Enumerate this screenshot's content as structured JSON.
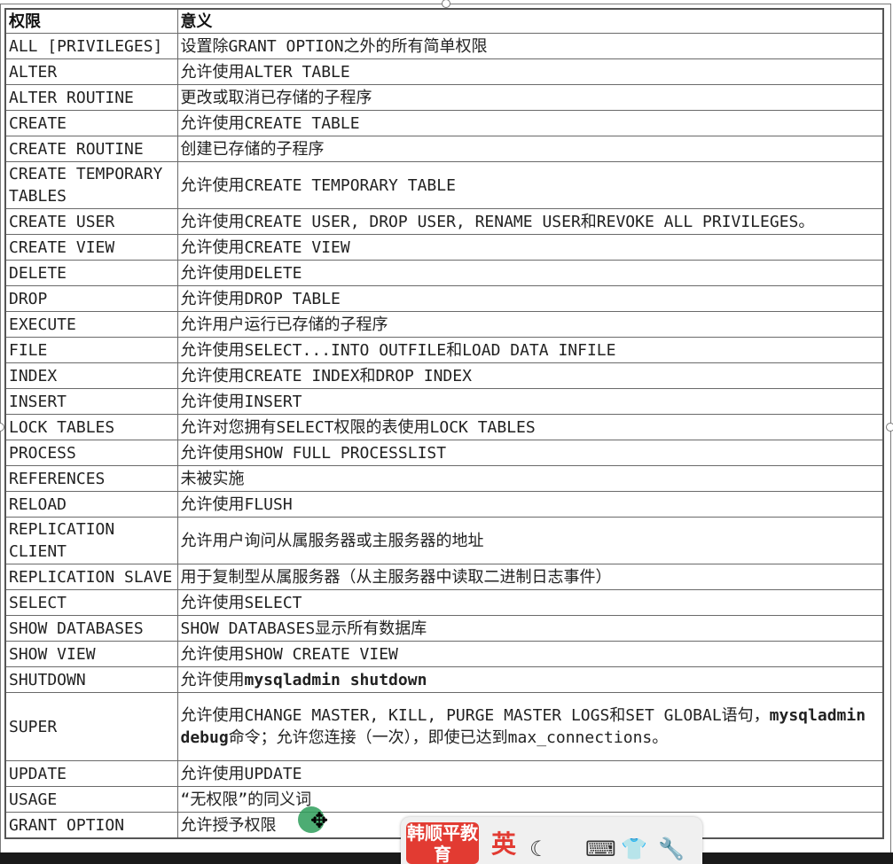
{
  "table": {
    "header": {
      "col1": "权限",
      "col2": "意义"
    },
    "rows": [
      {
        "priv": "ALL [PRIVILEGES]",
        "meaning": "设置除GRANT OPTION之外的所有简单权限",
        "h": 1
      },
      {
        "priv": "ALTER",
        "meaning": "允许使用ALTER TABLE",
        "h": 1
      },
      {
        "priv": "ALTER ROUTINE",
        "meaning": "更改或取消已存储的子程序",
        "h": 1
      },
      {
        "priv": "CREATE",
        "meaning": "允许使用CREATE TABLE",
        "h": 1
      },
      {
        "priv": "CREATE ROUTINE",
        "meaning": "创建已存储的子程序",
        "h": 1
      },
      {
        "priv": "CREATE TEMPORARY TABLES",
        "meaning": "允许使用CREATE TEMPORARY TABLE",
        "h": 2
      },
      {
        "priv": "CREATE USER",
        "meaning": "允许使用CREATE USER, DROP USER, RENAME USER和REVOKE ALL PRIVILEGES。",
        "h": 1
      },
      {
        "priv": "CREATE VIEW",
        "meaning": "允许使用CREATE VIEW",
        "h": 1
      },
      {
        "priv": "DELETE",
        "meaning": "允许使用DELETE",
        "h": 1
      },
      {
        "priv": "DROP",
        "meaning": "允许使用DROP TABLE",
        "h": 1
      },
      {
        "priv": "EXECUTE",
        "meaning": "允许用户运行已存储的子程序",
        "h": 1
      },
      {
        "priv": "FILE",
        "meaning": "允许使用SELECT...INTO OUTFILE和LOAD DATA INFILE",
        "h": 1
      },
      {
        "priv": "INDEX",
        "meaning": "允许使用CREATE INDEX和DROP INDEX",
        "h": 1
      },
      {
        "priv": "INSERT",
        "meaning": "允许使用INSERT",
        "h": 1
      },
      {
        "priv": "LOCK TABLES",
        "meaning": "允许对您拥有SELECT权限的表使用LOCK TABLES",
        "h": 1
      },
      {
        "priv": "PROCESS",
        "meaning": "允许使用SHOW FULL PROCESSLIST",
        "h": 1
      },
      {
        "priv": "REFERENCES",
        "meaning": "未被实施",
        "h": 1
      },
      {
        "priv": "RELOAD",
        "meaning": "允许使用FLUSH",
        "h": 1
      },
      {
        "priv": "REPLICATION CLIENT",
        "meaning": "允许用户询问从属服务器或主服务器的地址",
        "h": 2
      },
      {
        "priv": "REPLICATION SLAVE",
        "meaning": "用于复制型从属服务器（从主服务器中读取二进制日志事件）",
        "h": 1
      },
      {
        "priv": "SELECT",
        "meaning": "允许使用SELECT",
        "h": 1
      },
      {
        "priv": "SHOW DATABASES",
        "meaning": "SHOW DATABASES显示所有数据库",
        "h": 1
      },
      {
        "priv": "SHOW VIEW",
        "meaning": "允许使用SHOW CREATE VIEW",
        "h": 1
      },
      {
        "priv": "SHUTDOWN",
        "meaning_pre": "允许使用",
        "meaning_bold": "mysqladmin shutdown",
        "meaning_post": "",
        "h": 1
      },
      {
        "priv": "SUPER",
        "meaning_pre": "允许使用CHANGE MASTER, KILL, PURGE MASTER LOGS和SET GLOBAL语句，",
        "meaning_bold": "mysqladmin debug",
        "meaning_post": "命令；允许您连接（一次），即使已达到max_connections。",
        "h": 3
      },
      {
        "priv": "UPDATE",
        "meaning": "允许使用UPDATE",
        "h": 1
      },
      {
        "priv": "USAGE",
        "meaning": "“无权限”的同义词",
        "h": 1
      },
      {
        "priv": "GRANT OPTION",
        "meaning": "允许授予权限",
        "h": 1
      }
    ]
  },
  "taskbar": {
    "brand": "韩顺平教育",
    "ime_label": "英",
    "icons": [
      "moon-icon",
      "keyboard-icon",
      "shirt-icon",
      "wrench-icon"
    ]
  }
}
